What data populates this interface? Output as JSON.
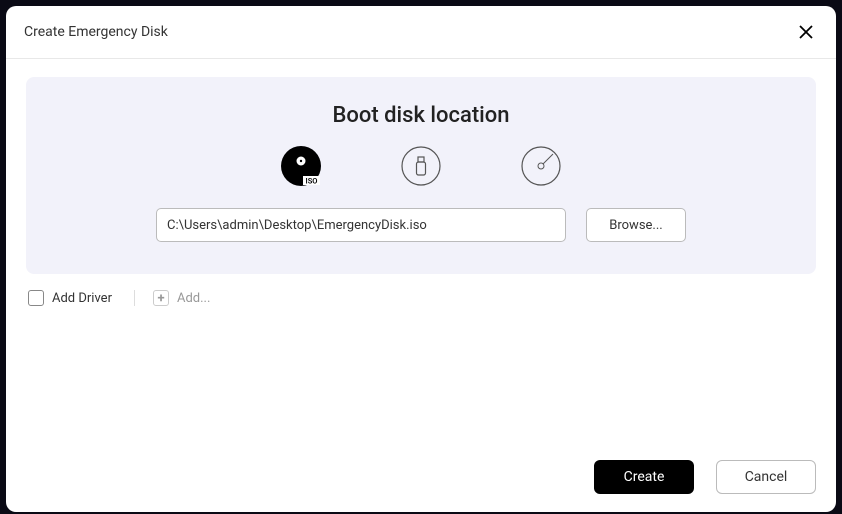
{
  "dialog": {
    "title": "Create Emergency Disk",
    "panel_title": "Boot disk location",
    "iso_badge": "ISO",
    "path_value": "C:\\Users\\admin\\Desktop\\EmergencyDisk.iso",
    "browse_label": "Browse...",
    "add_driver_label": "Add Driver",
    "add_label": "Add...",
    "create_label": "Create",
    "cancel_label": "Cancel"
  }
}
